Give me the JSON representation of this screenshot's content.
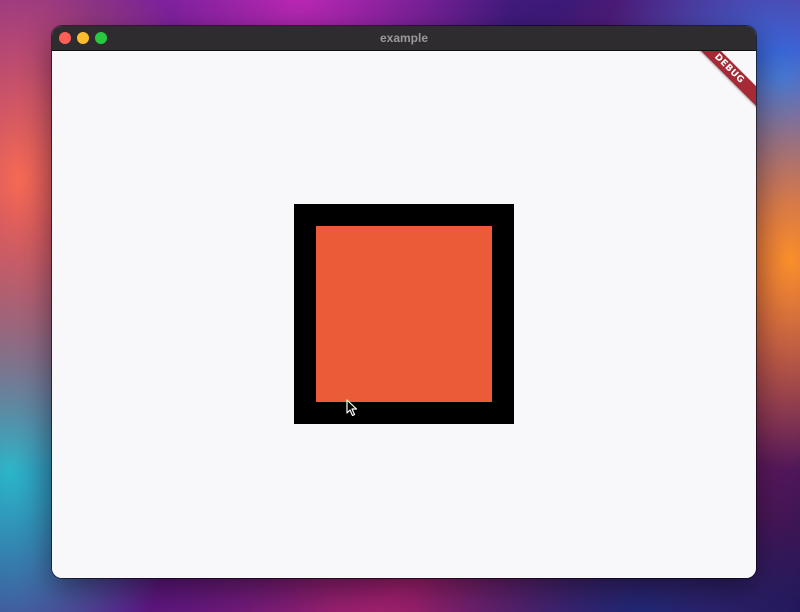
{
  "window": {
    "title": "example"
  },
  "debug_banner": {
    "label": "DEBUG"
  },
  "boxes": {
    "outer_color": "#000000",
    "inner_color": "#ec5b38"
  },
  "icons": {
    "close": "close-icon",
    "minimize": "minimize-icon",
    "maximize": "maximize-icon",
    "cursor": "mouse-pointer-icon"
  }
}
